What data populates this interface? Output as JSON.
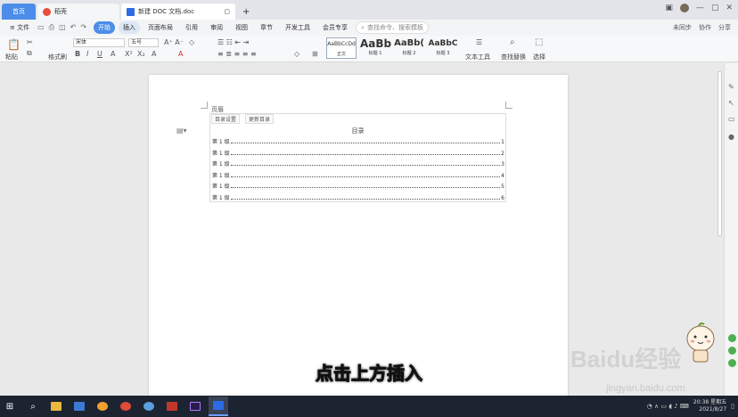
{
  "tabs": {
    "home": "首页",
    "daoke": "稻壳",
    "doc": "新建 DOC 文档.doc"
  },
  "menu": {
    "file": "文件",
    "items": [
      "开始",
      "插入",
      "页面布局",
      "引用",
      "审阅",
      "视图",
      "章节",
      "开发工具",
      "会员专享"
    ],
    "search": "查找命令、搜索模板",
    "right": [
      "未同步",
      "协作",
      "分享"
    ]
  },
  "ribbon": {
    "paste": "粘贴",
    "fmt": "格式刷",
    "font": "宋体",
    "size": "五号",
    "styles": [
      {
        "sample": "AaBbCcDd",
        "label": "正文"
      },
      {
        "sample": "AaBb",
        "label": "标题 1"
      },
      {
        "sample": "AaBb(",
        "label": "标题 2"
      },
      {
        "sample": "AaBbC",
        "label": "标题 3"
      }
    ],
    "text_tools": "文本工具",
    "find": "查找替换",
    "select": "选择"
  },
  "doc": {
    "header_label": "页眉",
    "toc_tool1": "目录设置",
    "toc_tool2": "更新目录",
    "toc_title": "目录",
    "rows": [
      {
        "text": "第 1 级",
        "page": "1"
      },
      {
        "text": "第 1 级",
        "page": "2"
      },
      {
        "text": "第 1 级",
        "page": "3"
      },
      {
        "text": "第 1 级",
        "page": "4"
      },
      {
        "text": "第 1 级",
        "page": "5"
      },
      {
        "text": "第 1 级",
        "page": "6"
      }
    ]
  },
  "subtitle": "点击上方插入",
  "watermark": "Baidu经验",
  "watermark_url": "jingyan.baidu.com",
  "clock": {
    "time": "20:38",
    "date": "2021/8/27",
    "day": "星期五"
  }
}
